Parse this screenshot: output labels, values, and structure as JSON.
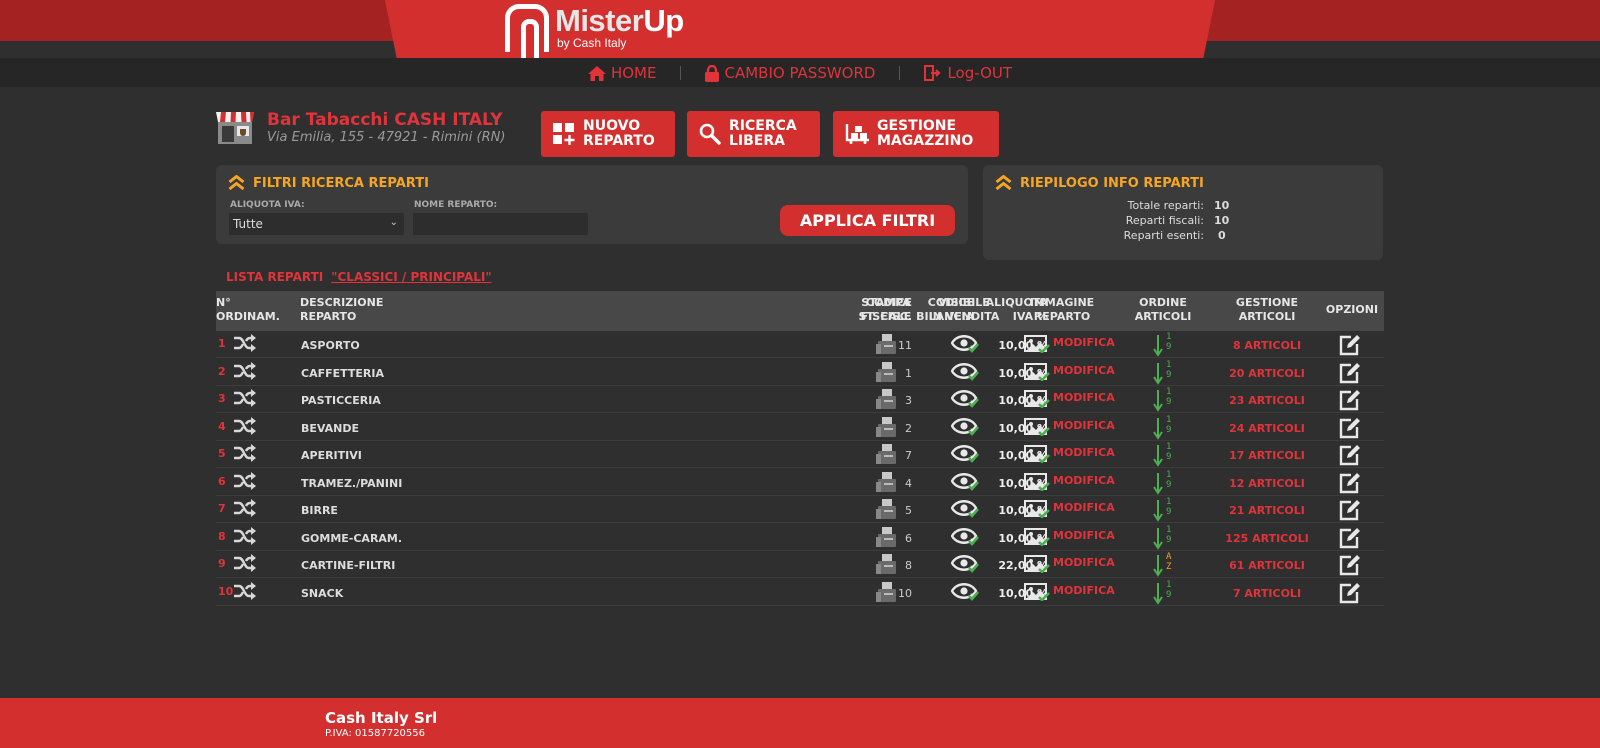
{
  "brand": {
    "name_a": "Mister",
    "name_b": "Up",
    "sub": "by Cash Italy"
  },
  "nav": [
    {
      "label": "HOME",
      "icon": "home-icon"
    },
    {
      "label": "CAMBIO PASSWORD",
      "icon": "lock-icon"
    },
    {
      "label": "Log-OUT",
      "icon": "logout-icon"
    }
  ],
  "store": {
    "name": "Bar Tabacchi CASH ITALY",
    "address": "Via Emilia, 155 - 47921 - Rimini (RN)"
  },
  "actions": {
    "nuovo": [
      "NUOVO",
      "REPARTO"
    ],
    "ricerca": [
      "RICERCA",
      "LIBERA"
    ],
    "magazzino": [
      "GESTIONE",
      "MAGAZZINO"
    ]
  },
  "filters": {
    "title": "FILTRI RICERCA REPARTI",
    "aliquota_label": "ALIQUOTA IVA:",
    "aliquota_value": "Tutte",
    "nome_label": "NOME REPARTO:",
    "nome_value": "",
    "apply_label": "APPLICA FILTRI"
  },
  "info": {
    "title": "RIEPILOGO INFO REPARTI",
    "rows": [
      {
        "k": "Totale reparti:",
        "v": "10"
      },
      {
        "k": "Reparti fiscali:",
        "v": "10"
      },
      {
        "k": "Reparti esenti:",
        "v": "0"
      }
    ]
  },
  "list": {
    "prefix": "LISTA REPARTI",
    "category": "\"CLASSICI / PRINCIPALI\""
  },
  "columns": {
    "num": [
      "N°",
      "ORDINAM."
    ],
    "desc": [
      "DESCRIZIONE",
      "REPARTO"
    ],
    "cod": [
      "CODICE",
      "ST. FISC."
    ],
    "bil": [
      "CODICE",
      "BILANCIA"
    ],
    "iva": [
      "ALIQUOTA",
      "IVA %"
    ],
    "stampa": [
      "STAMPA",
      "FISCALE"
    ],
    "vis": [
      "VISIBILE",
      "IN VENDITA"
    ],
    "img": [
      "IMMAGINE",
      "REPARTO"
    ],
    "ord": [
      "ORDINE",
      "ARTICOLI"
    ],
    "gest": [
      "GESTIONE",
      "ARTICOLI"
    ],
    "opz": [
      "OPZIONI"
    ]
  },
  "modifica_label": "MODIFICA",
  "rows": [
    {
      "n": "1",
      "desc": "ASPORTO",
      "cod": "11",
      "bil": "-",
      "iva": "10,00 %",
      "ord": [
        "1",
        "9"
      ],
      "art": "8 ARTICOLI"
    },
    {
      "n": "2",
      "desc": "CAFFETTERIA",
      "cod": "1",
      "bil": "-",
      "iva": "10,00 %",
      "ord": [
        "1",
        "9"
      ],
      "art": "20 ARTICOLI"
    },
    {
      "n": "3",
      "desc": "PASTICCERIA",
      "cod": "3",
      "bil": "-",
      "iva": "10,00 %",
      "ord": [
        "1",
        "9"
      ],
      "art": "23 ARTICOLI"
    },
    {
      "n": "4",
      "desc": "BEVANDE",
      "cod": "2",
      "bil": "-",
      "iva": "10,00 %",
      "ord": [
        "1",
        "9"
      ],
      "art": "24 ARTICOLI"
    },
    {
      "n": "5",
      "desc": "APERITIVI",
      "cod": "7",
      "bil": "-",
      "iva": "10,00 %",
      "ord": [
        "1",
        "9"
      ],
      "art": "17 ARTICOLI"
    },
    {
      "n": "6",
      "desc": "TRAMEZ./PANINI",
      "cod": "4",
      "bil": "-",
      "iva": "10,00 %",
      "ord": [
        "1",
        "9"
      ],
      "art": "12 ARTICOLI"
    },
    {
      "n": "7",
      "desc": "BIRRE",
      "cod": "5",
      "bil": "-",
      "iva": "10,00 %",
      "ord": [
        "1",
        "9"
      ],
      "art": "21 ARTICOLI"
    },
    {
      "n": "8",
      "desc": "GOMME-CARAM.",
      "cod": "6",
      "bil": "-",
      "iva": "10,00 %",
      "ord": [
        "1",
        "9"
      ],
      "art": "125 ARTICOLI"
    },
    {
      "n": "9",
      "desc": "CARTINE-FILTRI",
      "cod": "8",
      "bil": "-",
      "iva": "22,00 %",
      "ord": [
        "A",
        "Z"
      ],
      "art": "61 ARTICOLI"
    },
    {
      "n": "10",
      "desc": "SNACK",
      "cod": "10",
      "bil": "-",
      "iva": "10,00 %",
      "ord": [
        "1",
        "9"
      ],
      "art": "7 ARTICOLI"
    }
  ],
  "footer": {
    "company": "Cash Italy Srl",
    "piva": "P.IVA: 01587720556"
  },
  "colors": {
    "accent": "#d32f2f",
    "accent_text": "#e0333a",
    "header_dark": "#a52222",
    "bg": "#2f2f2f",
    "panel": "#3b3b3b",
    "title_orange": "#f5a623",
    "green": "#4caf50"
  }
}
